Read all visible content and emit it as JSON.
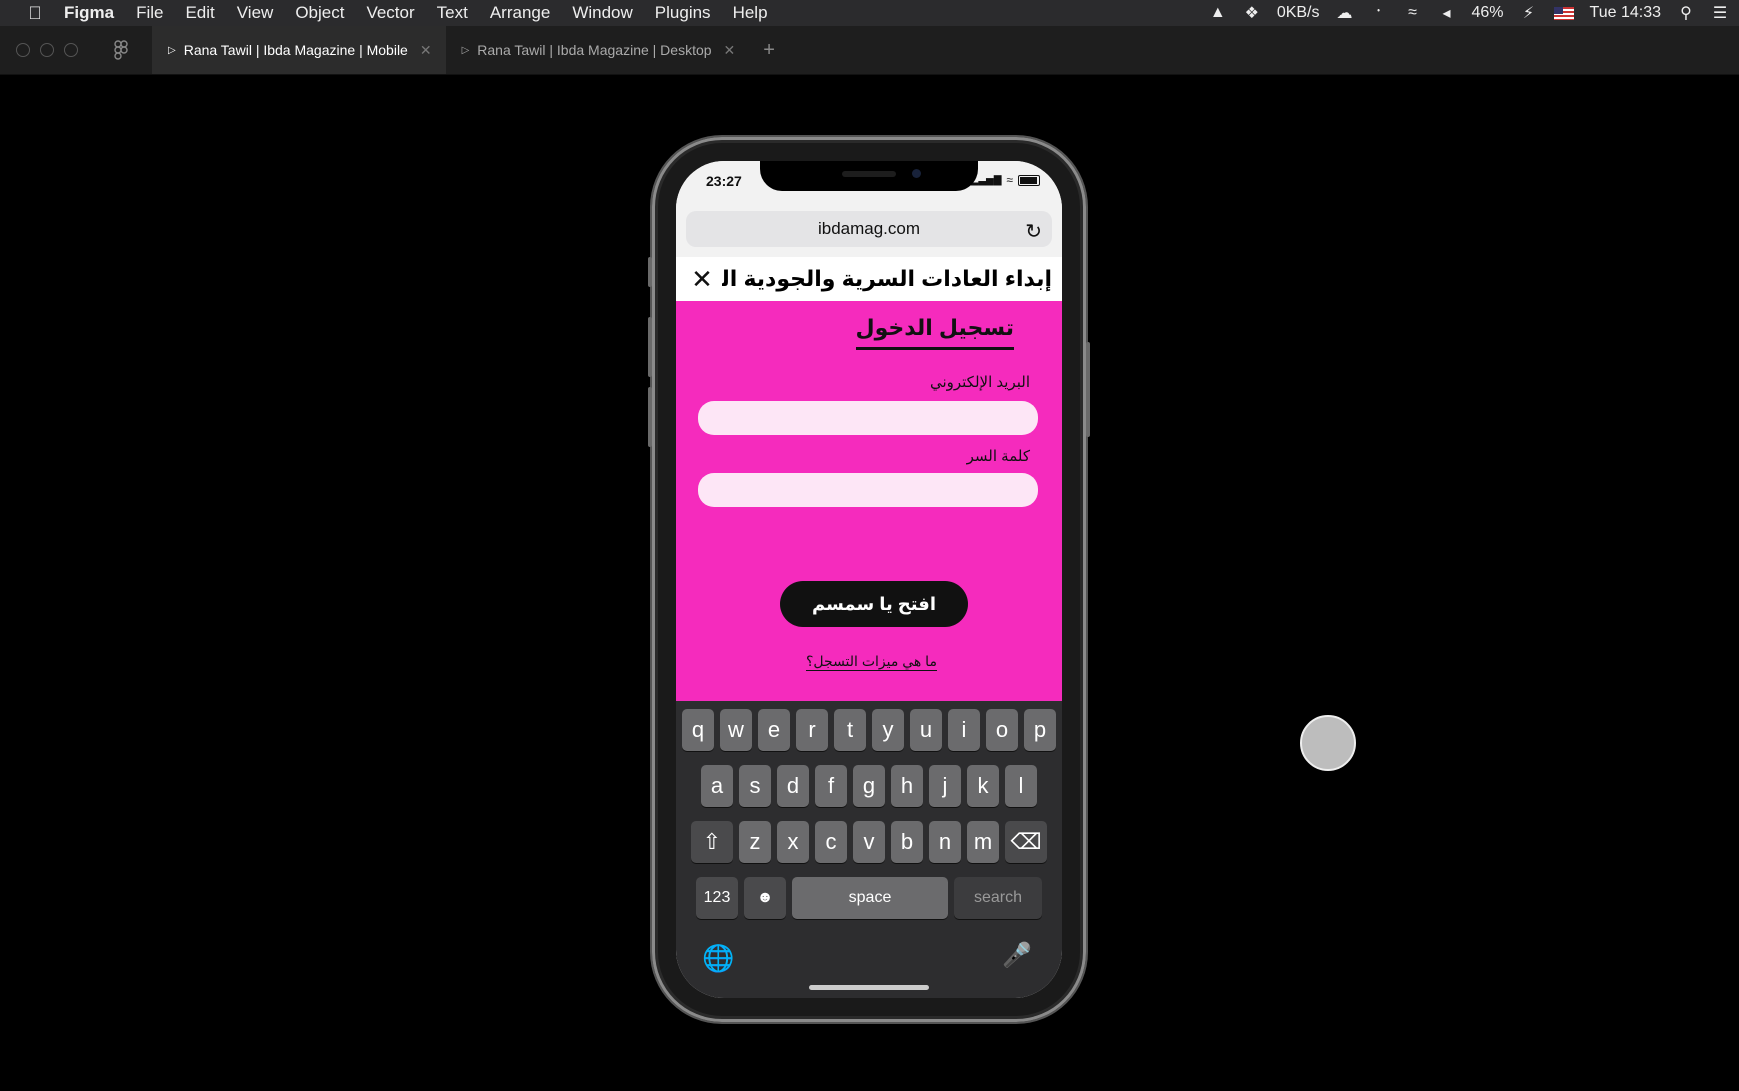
{
  "menubar": {
    "apple": "",
    "items": [
      "Figma",
      "File",
      "Edit",
      "View",
      "Object",
      "Vector",
      "Text",
      "Arrange",
      "Window",
      "Plugins",
      "Help"
    ],
    "net_speed": "0KB/s",
    "battery": "46%",
    "clock": "Tue 14:33"
  },
  "tabs": [
    {
      "label": "Rana Tawil | Ibda Magazine | Mobile",
      "active": true
    },
    {
      "label": "Rana Tawil | Ibda Magazine | Desktop",
      "active": false
    }
  ],
  "phone": {
    "time": "23:27",
    "url": "ibdamag.com",
    "site_logo": "إبداء العادات السرية والجودية الخفية",
    "login": {
      "title": "تسجيل الدخول",
      "email_label": "البريد الإلكتروني",
      "email_value": "",
      "password_label": "كلمة السر",
      "password_value": "",
      "submit": "افتح يا سمسم",
      "benefits_link": "ما هي ميزات التسجل؟"
    },
    "keyboard": {
      "row1": [
        "q",
        "w",
        "e",
        "r",
        "t",
        "y",
        "u",
        "i",
        "o",
        "p"
      ],
      "row2": [
        "a",
        "s",
        "d",
        "f",
        "g",
        "h",
        "j",
        "k",
        "l"
      ],
      "row3": [
        "z",
        "x",
        "c",
        "v",
        "b",
        "n",
        "m"
      ],
      "numbers": "123",
      "space": "space",
      "search": "search"
    }
  },
  "colors": {
    "login_bg": "#f52bbd",
    "field_bg": "#fde6f6",
    "button_bg": "#111111"
  }
}
